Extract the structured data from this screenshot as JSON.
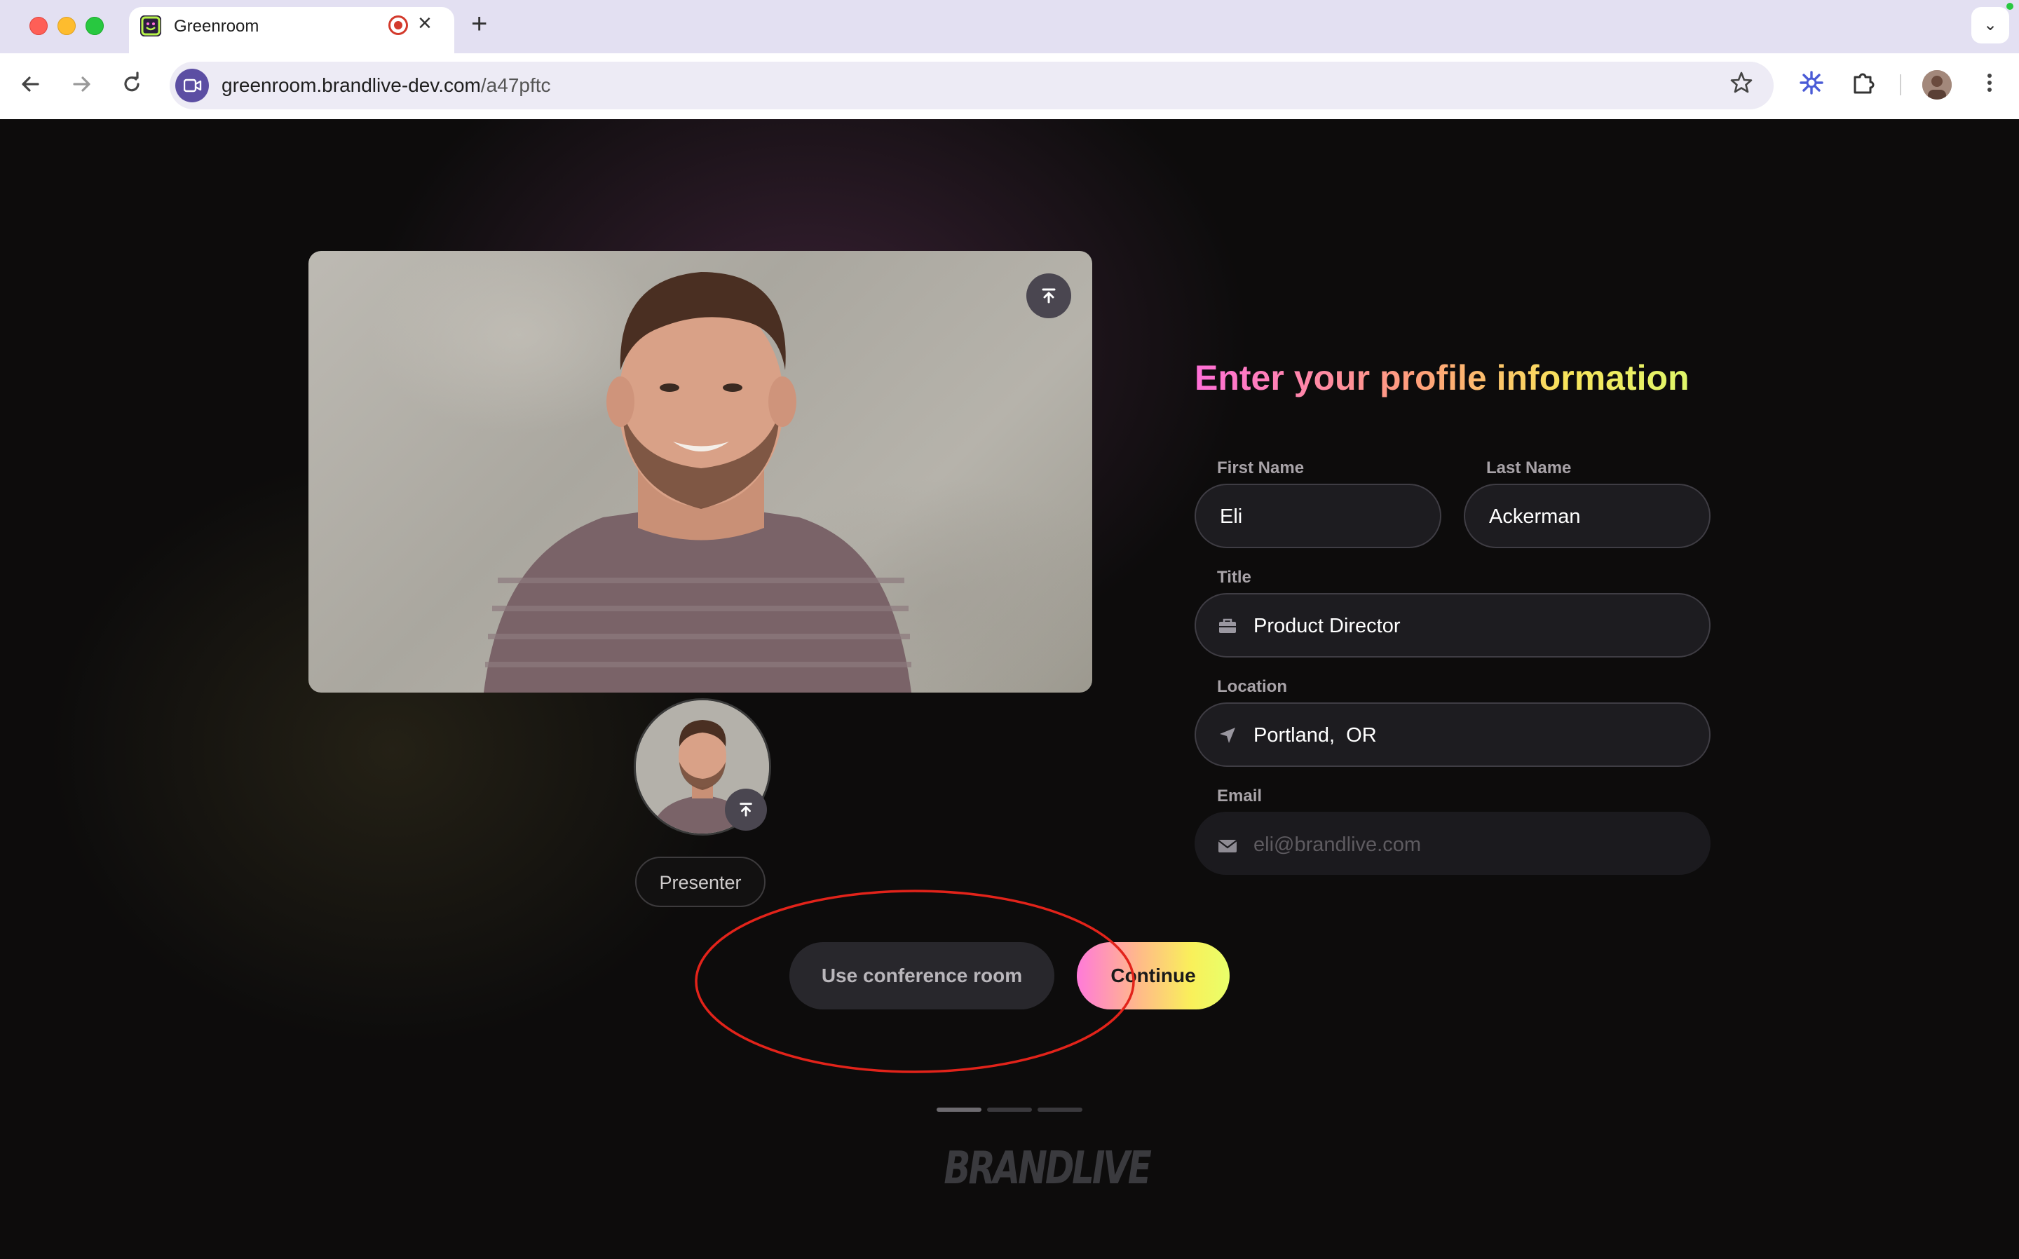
{
  "browser": {
    "tab_title": "Greenroom",
    "url_host": "greenroom.brandlive-dev.com",
    "url_path": "/a47pftc",
    "new_tab_symbol": "+",
    "close_symbol": "×",
    "icons": [
      "back-arrow-icon",
      "forward-arrow-icon",
      "reload-icon",
      "video-site-icon",
      "star-icon",
      "extension-snowflake-icon",
      "puzzle-icon",
      "profile-avatar",
      "kebab-menu-icon"
    ]
  },
  "profile_form": {
    "heading": "Enter your profile information",
    "first_name": {
      "label": "First Name",
      "value": "Eli"
    },
    "last_name": {
      "label": "Last Name",
      "value": "Ackerman"
    },
    "title": {
      "label": "Title",
      "value": "Product Director",
      "icon": "briefcase-icon"
    },
    "location": {
      "label": "Location",
      "value": "Portland,  OR",
      "icon": "location-arrow-icon"
    },
    "email": {
      "label": "Email",
      "placeholder": "eli@brandlive.com",
      "icon": "mail-icon"
    }
  },
  "preview": {
    "role_badge": "Presenter"
  },
  "actions": {
    "conference_room_label": "Use conference room",
    "continue_label": "Continue"
  },
  "steps": {
    "total": 3,
    "current": 1
  },
  "brand": {
    "logo_text": "BRANDLIVE"
  },
  "colors": {
    "heading_gradient": [
      "#ff6fd8",
      "#ff9f7a",
      "#f8e45c",
      "#dff86a"
    ],
    "annotation": "#e2231a",
    "page_bg": "#0d0c0c"
  }
}
